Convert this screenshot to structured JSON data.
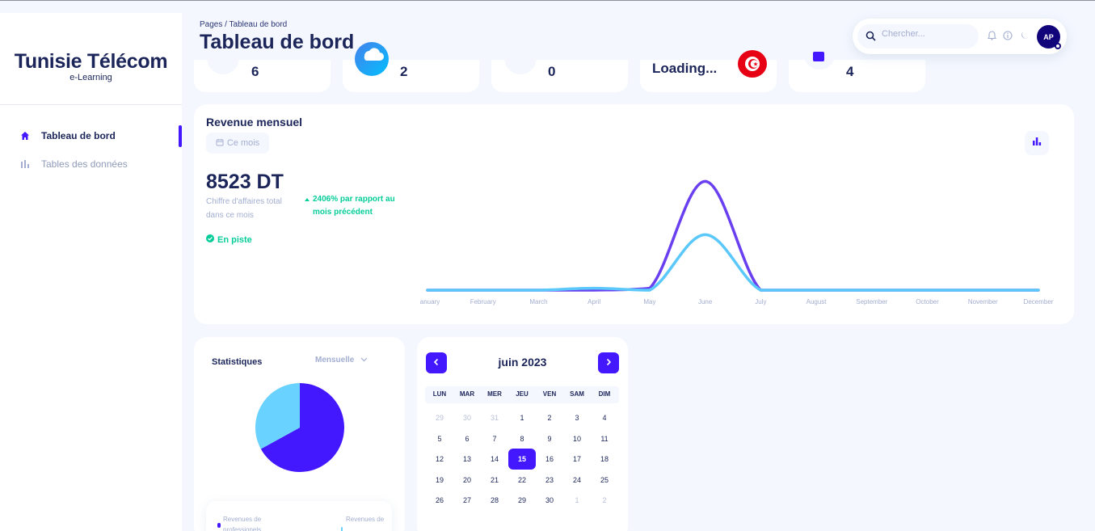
{
  "sidebar": {
    "brand_title": "Tunisie Télécom",
    "brand_subtitle": "e-Learning",
    "items": [
      {
        "label": "Tableau de bord",
        "icon": "home-icon",
        "active": true
      },
      {
        "label": "Tables des données",
        "icon": "bar-chart-icon",
        "active": false
      }
    ]
  },
  "header": {
    "breadcrumb": "Pages  /  Tableau de bord",
    "title": "Tableau de bord"
  },
  "topbar": {
    "search_placeholder": "Chercher...",
    "avatar_initials": "AP",
    "icons": [
      "bell-icon",
      "info-icon",
      "moon-icon"
    ]
  },
  "stat_cards": [
    {
      "value": "6",
      "icon": "users-icon"
    },
    {
      "value": "2",
      "icon": "cloud-icon"
    },
    {
      "value": "0",
      "icon": "user-icon"
    },
    {
      "value": "Loading...",
      "icon": "tunisia-flag-icon"
    },
    {
      "value": "4",
      "icon": "task-icon"
    }
  ],
  "revenue": {
    "title": "Revenue mensuel",
    "period": "Ce mois",
    "amount": "8523 DT",
    "amount_label": "Chiffre d'affaires total dans ce mois",
    "growth": "2406% par rapport au mois précédent",
    "status": "En piste",
    "colors": {
      "series1": "#6a3ff0",
      "series2": "#5ac8fa"
    }
  },
  "chart_data": {
    "type": "line",
    "x": [
      "January",
      "February",
      "March",
      "April",
      "May",
      "June",
      "July",
      "August",
      "September",
      "October",
      "November",
      "December"
    ],
    "categories": [
      "anuary",
      "February",
      "March",
      "April",
      "May",
      "June",
      "July",
      "August",
      "September",
      "October",
      "November",
      "December"
    ],
    "series": [
      {
        "values": [
          0,
          0,
          0,
          0,
          150,
          8523,
          0,
          0,
          0,
          0,
          0,
          0
        ],
        "color": "#6a3ff0"
      },
      {
        "values": [
          0,
          0,
          0,
          150,
          0,
          4350,
          0,
          0,
          0,
          0,
          0,
          0
        ],
        "color": "#5ac8fa"
      }
    ],
    "ylim": [
      0,
      9500
    ],
    "grid": false,
    "legend": "none"
  },
  "statistics": {
    "title": "Statistiques",
    "select_value": "Mensuelle",
    "pie": [
      {
        "value": 67,
        "color": "#4318ff"
      },
      {
        "value": 33,
        "color": "#6ad2ff"
      }
    ],
    "legend": [
      {
        "label": "Revenues de professionels",
        "color": "#4318ff"
      },
      {
        "label": "Revenues de",
        "color": "#6ad2ff"
      }
    ]
  },
  "calendar": {
    "title": "juin 2023",
    "days_of_week": [
      "LUN",
      "MAR",
      "MER",
      "JEU",
      "VEN",
      "SAM",
      "DIM"
    ],
    "weeks": [
      [
        "29",
        "30",
        "31",
        "1",
        "2",
        "3",
        "4"
      ],
      [
        "5",
        "6",
        "7",
        "8",
        "9",
        "10",
        "11"
      ],
      [
        "12",
        "13",
        "14",
        "15",
        "16",
        "17",
        "18"
      ],
      [
        "19",
        "20",
        "21",
        "22",
        "23",
        "24",
        "25"
      ],
      [
        "26",
        "27",
        "28",
        "29",
        "30",
        "1",
        "2"
      ]
    ],
    "selected": "15"
  }
}
